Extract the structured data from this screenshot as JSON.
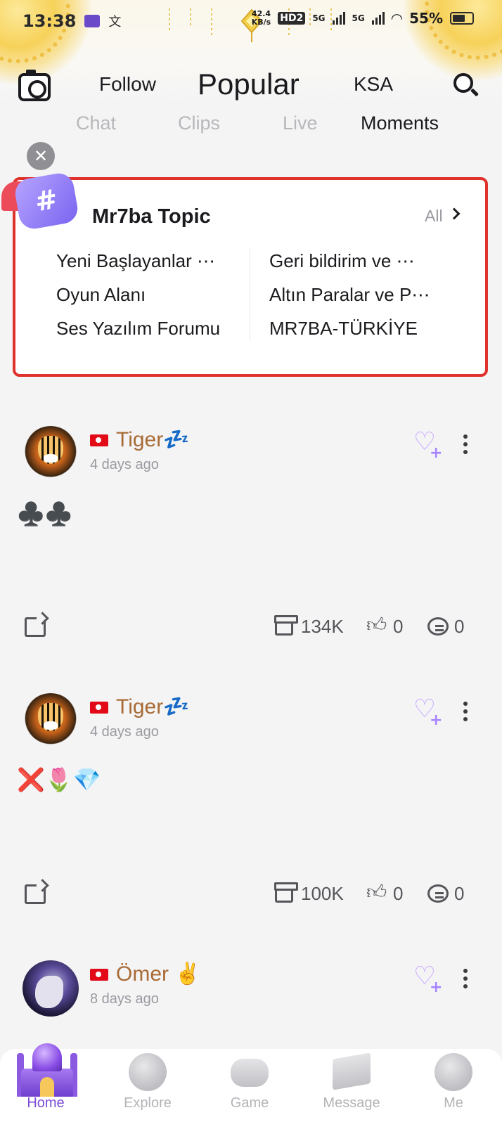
{
  "status_bar": {
    "time": "13:38",
    "network_speed_value": "42.4",
    "network_speed_unit": "KB/s",
    "hd_label": "HD2",
    "net1": "5G",
    "net2": "5G",
    "battery": "55%"
  },
  "top_tabs": {
    "follow": "Follow",
    "popular": "Popular",
    "ksa": "KSA"
  },
  "sub_tabs": {
    "chat": "Chat",
    "clips": "Clips",
    "live": "Live",
    "moments": "Moments",
    "selected": "Moments"
  },
  "topic_card": {
    "title": "Mr7ba Topic",
    "all_label": "All",
    "left_items": [
      "Yeni Başlayanlar ⋯",
      "Oyun Alanı",
      "Ses Yazılım Forumu"
    ],
    "right_items": [
      "Geri bildirim ve ⋯",
      "Altın Paralar ve P⋯",
      "MR7BA-TÜRKİYE"
    ],
    "highlight_color": "#e0322c"
  },
  "posts": [
    {
      "username": "Tiger💤",
      "time": "4 days ago",
      "content": "♣️♣️",
      "gifts": "134K",
      "likes": "0",
      "comments": "0"
    },
    {
      "username": "Tiger💤",
      "time": "4 days ago",
      "content": "❌🌷💎",
      "gifts": "100K",
      "likes": "0",
      "comments": "0"
    },
    {
      "username": "Ömer ✌️",
      "time": "8 days ago"
    }
  ],
  "bottom_nav": {
    "home": "Home",
    "explore": "Explore",
    "game": "Game",
    "message": "Message",
    "me": "Me",
    "active": "Home",
    "active_color": "#7b4cd8"
  },
  "icons": {
    "camera": "camera-icon",
    "search": "search-icon",
    "close": "close-icon",
    "topic": "hashtag-icon",
    "follow": "heart-plus-icon",
    "more": "more-dots-icon",
    "share": "share-icon",
    "gift": "gift-icon",
    "like": "thumbs-up-icon",
    "comment": "comment-icon"
  }
}
